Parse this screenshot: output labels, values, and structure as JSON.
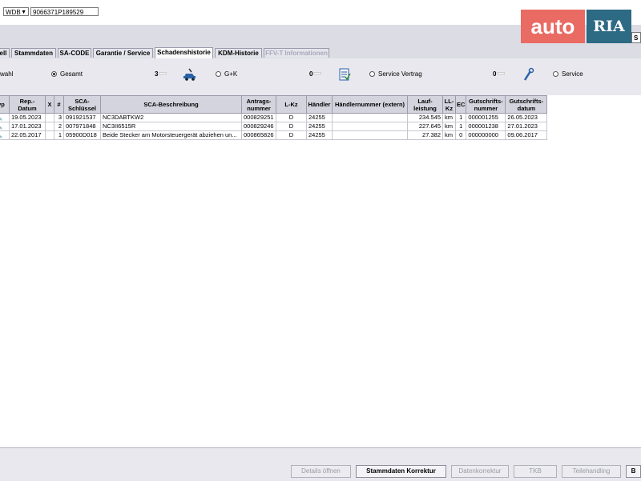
{
  "topbar": {
    "vin_prefix": "WDB",
    "vin_value": "9066371P189529"
  },
  "watermark": {
    "part1": "auto",
    "part2": "RIA"
  },
  "search_button_label": "S",
  "tabs": [
    {
      "label": "ell"
    },
    {
      "label": "Stammdaten"
    },
    {
      "label": "SA-CODE"
    },
    {
      "label": "Garantie / Service"
    },
    {
      "label": "Schadenshistorie",
      "active": true
    },
    {
      "label": "KDM-Historie"
    },
    {
      "label": "FFV-T Informationen",
      "disabled": true
    }
  ],
  "filter": {
    "label": "wahl",
    "options": [
      {
        "label": "Gesamt",
        "count": "3",
        "icon": "car-wrench-icon",
        "selected": true
      },
      {
        "label": "G+K",
        "count": "0",
        "icon": "checklist-icon",
        "selected": false
      },
      {
        "label": "Service Vertrag",
        "count": "0",
        "icon": "wrench-icon",
        "selected": false
      },
      {
        "label": "Service",
        "count": "",
        "icon": "",
        "selected": false
      }
    ]
  },
  "table": {
    "headers": [
      "yp",
      "Rep.-Datum",
      "X",
      "#",
      "SCA-Schlüssel",
      "SCA-Beschreibung",
      "Antrags-nummer",
      "L-Kz",
      "Händler",
      "Händlernummer (extern)",
      "Lauf-leistung",
      "LL-Kz",
      "EC",
      "Gutschrifts-nummer",
      "Gutschrifts-datum"
    ],
    "rows": [
      [
        "",
        "19.05.2023",
        "",
        "3",
        "091921537",
        "NC3DABTKW2",
        "000829251",
        "D",
        "24255",
        "",
        "234.545",
        "km",
        "1",
        "000001255",
        "26.05.2023"
      ],
      [
        "",
        "17.01.2023",
        "",
        "2",
        "007971848",
        "NC3II6515R",
        "000829246",
        "D",
        "24255",
        "",
        "227.645",
        "km",
        "1",
        "000001238",
        "27.01.2023"
      ],
      [
        "",
        "22.05.2017",
        "",
        "1",
        "05900D018",
        "Beide Stecker am Motorsteuergerät abziehen un...",
        "000865826",
        "D",
        "24255",
        "",
        "27.382",
        "km",
        "0",
        "000000000",
        "09.06.2017"
      ]
    ]
  },
  "buttons": [
    {
      "label": "Details öffnen",
      "enabled": false
    },
    {
      "label": "Stammdaten Korrektur",
      "enabled": true
    },
    {
      "label": "Datenkorrektur",
      "enabled": false
    },
    {
      "label": "TKB",
      "enabled": false
    },
    {
      "label": "Teilehandling",
      "enabled": false
    },
    {
      "label": "B",
      "enabled": true
    }
  ],
  "colors": {
    "band": "#dcdce4",
    "filter_band": "#e8e8ee",
    "watermark_red": "#e96b63",
    "watermark_blue": "#2d6a83",
    "icon_blue": "#2a62a8"
  }
}
